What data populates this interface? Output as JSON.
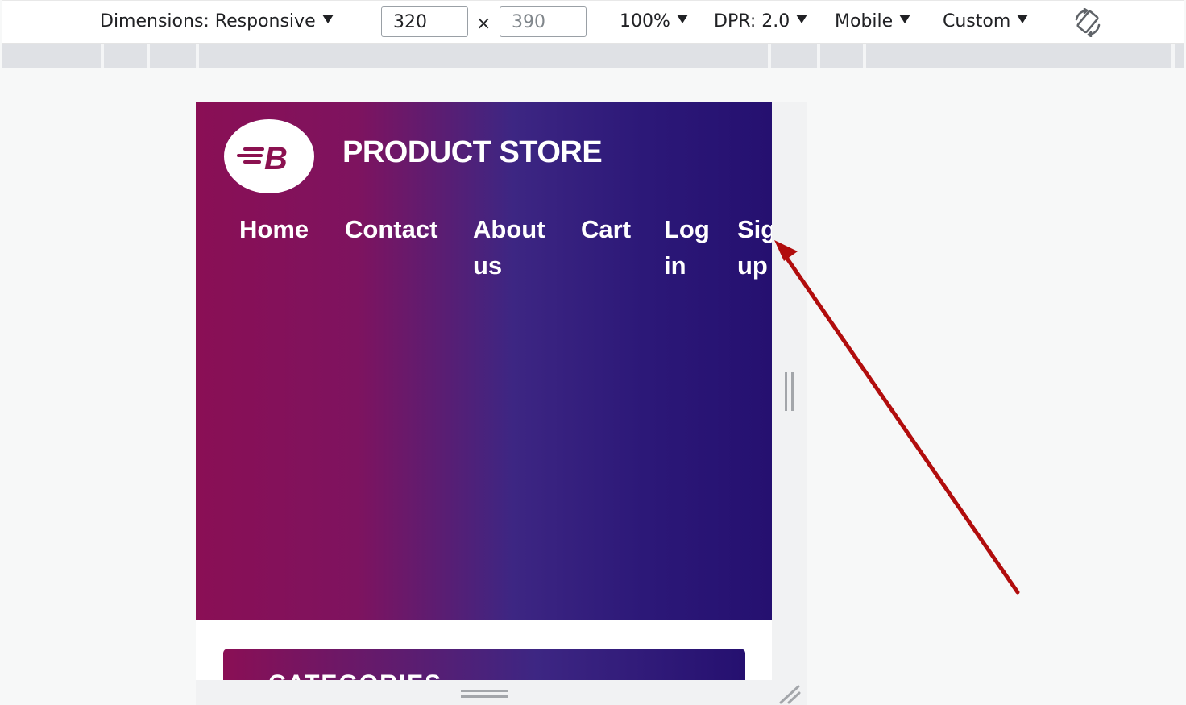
{
  "toolbar": {
    "dimensions_label": "Dimensions: Responsive",
    "width_value": "320",
    "times_symbol": "×",
    "height_value": "390",
    "zoom_label": "100%",
    "dpr_label": "DPR: 2.0",
    "device_label": "Mobile",
    "throttle_label": "Custom",
    "rotate_icon": "rotate-icon"
  },
  "page": {
    "logo_letter": "B",
    "store_title": "PRODUCT STORE",
    "nav": [
      {
        "label_line1": "Home",
        "label_line2": ""
      },
      {
        "label_line1": "Contact",
        "label_line2": ""
      },
      {
        "label_line1": "About",
        "label_line2": "us"
      },
      {
        "label_line1": "Cart",
        "label_line2": ""
      },
      {
        "label_line1": "Log",
        "label_line2": "in"
      },
      {
        "label_line1": "Sign",
        "label_line2": "up"
      }
    ],
    "categories_label": "CATEGORIES"
  },
  "annotation": {
    "arrow_color": "#b10d0d"
  },
  "colors": {
    "hero_start": "#8a0f55",
    "hero_end": "#251070",
    "logo_color": "#8b1150"
  }
}
